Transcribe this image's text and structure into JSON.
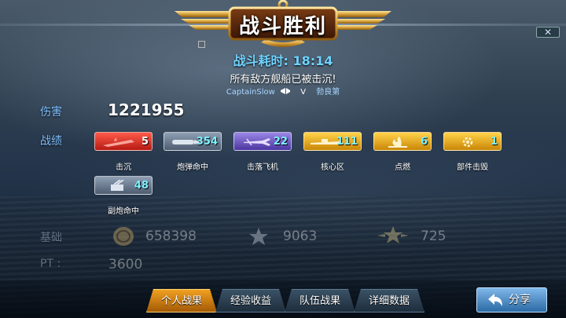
{
  "header": {
    "title": "战斗胜利",
    "close_label": "✕"
  },
  "battle": {
    "time_label": "战斗耗时: 18:14",
    "result_text": "所有敌方舰船已被击沉!",
    "player": "CaptainSlow",
    "player_icon": "ship-class-icon",
    "versus": "V",
    "opponent": "勃良第"
  },
  "stats": {
    "damage_label": "伤害",
    "damage_value": "1221955",
    "record_label": "战绩",
    "badges": [
      {
        "label": "击沉",
        "value": "5",
        "color": "#d8281c",
        "icon": "sunk-ship-icon"
      },
      {
        "label": "炮弹命中",
        "value": "354",
        "color": "#6b7b8f",
        "icon": "shell-hit-icon"
      },
      {
        "label": "击落飞机",
        "value": "22",
        "color": "#6a52c4",
        "icon": "plane-shotdown-icon"
      },
      {
        "label": "核心区",
        "value": "111",
        "color": "#e6a515",
        "icon": "citadel-icon"
      },
      {
        "label": "点燃",
        "value": "6",
        "color": "#e6a515",
        "icon": "fire-icon"
      },
      {
        "label": "部件击毁",
        "value": "1",
        "color": "#e6a515",
        "icon": "module-destroyed-icon"
      },
      {
        "label": "副炮命中",
        "value": "48",
        "color": "#6b7b8f",
        "icon": "secondary-hit-icon"
      }
    ]
  },
  "rewards": {
    "basis_label": "基础",
    "credits": "658398",
    "xp": "9063",
    "commander_xp": "725",
    "pt_label": "PT :",
    "pt_value": "3600"
  },
  "tabs": [
    {
      "label": "个人战果",
      "active": true
    },
    {
      "label": "经验收益",
      "active": false
    },
    {
      "label": "队伍战果",
      "active": false
    },
    {
      "label": "详细数据",
      "active": false
    }
  ],
  "share_label": "分享"
}
